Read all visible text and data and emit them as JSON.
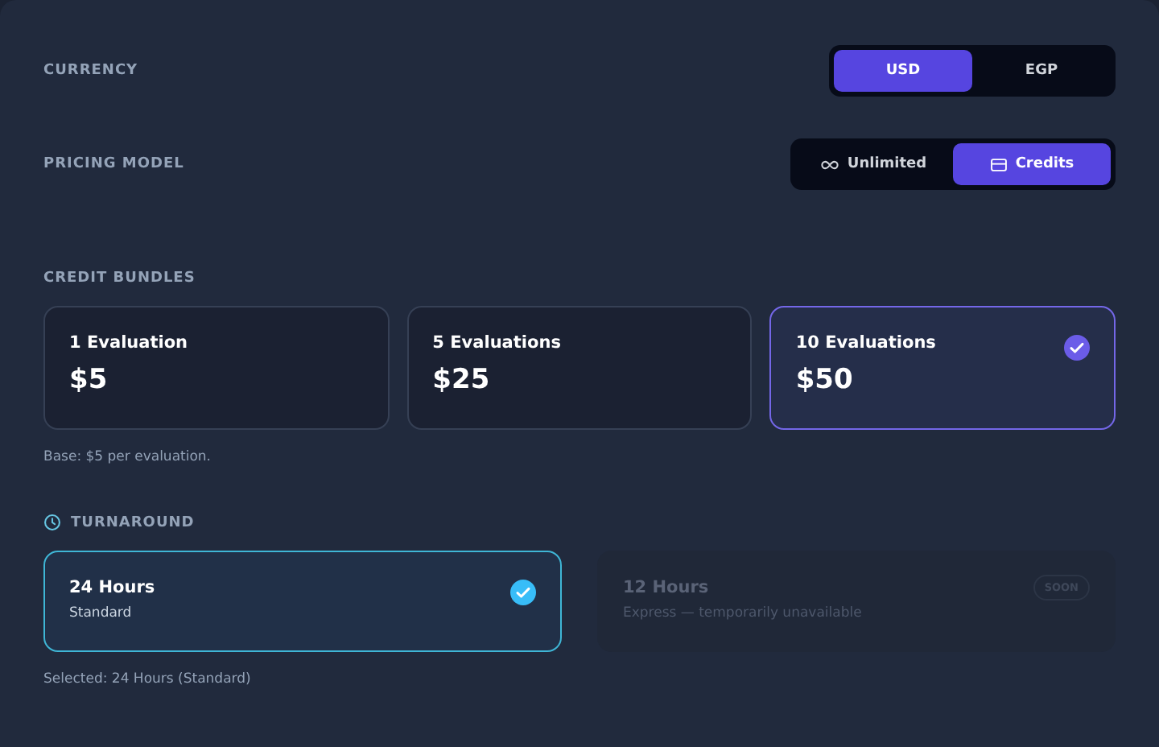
{
  "currency": {
    "label": "CURRENCY",
    "options": [
      {
        "label": "USD",
        "selected": true
      },
      {
        "label": "EGP",
        "selected": false
      }
    ]
  },
  "pricing_model": {
    "label": "PRICING MODEL",
    "options": [
      {
        "label": "Unlimited",
        "kind": "infinity",
        "selected": false
      },
      {
        "label": "Credits",
        "kind": "card",
        "selected": true
      }
    ]
  },
  "credit_bundles": {
    "label": "CREDIT BUNDLES",
    "items": [
      {
        "title": "1 Evaluation",
        "price": "$5",
        "selected": false
      },
      {
        "title": "5 Evaluations",
        "price": "$25",
        "selected": false
      },
      {
        "title": "10 Evaluations",
        "price": "$50",
        "selected": true
      }
    ],
    "note": "Base: $5 per evaluation."
  },
  "turnaround": {
    "label": "TURNAROUND",
    "options": [
      {
        "title": "24 Hours",
        "subtitle": "Standard",
        "selected": true,
        "disabled": false
      },
      {
        "title": "12 Hours",
        "subtitle": "Express — temporarily unavailable",
        "selected": false,
        "disabled": true,
        "badge": "SOON"
      }
    ],
    "note": "Selected: 24 Hours (Standard)"
  }
}
